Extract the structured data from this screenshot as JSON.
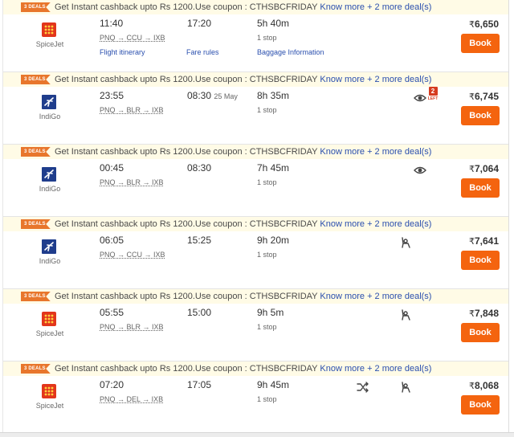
{
  "deal": {
    "badge": "3 DEALS",
    "text": "Get Instant cashback upto Rs 1200.Use coupon : CTHSBCFRIDAY ",
    "know_more": "Know more",
    "more_deals": "+ 2 more deal(s)"
  },
  "book_label": "Book",
  "currency": "₹",
  "links": {
    "itinerary": "Flight itinerary",
    "fare_rules": "Fare rules",
    "baggage": "Baggage Information"
  },
  "seats": {
    "count": "2",
    "label": "LEFT"
  },
  "flights": [
    {
      "airline": "SpiceJet",
      "dep": "11:40",
      "arr": "17:20",
      "arr_date": "",
      "route": "PNQ → CCU → IXB",
      "duration": "5h 40m",
      "stops": "1 stop",
      "price": "6,650"
    },
    {
      "airline": "IndiGo",
      "dep": "23:55",
      "arr": "08:30",
      "arr_date": "25 May",
      "route": "PNQ → BLR → IXB",
      "duration": "8h 35m",
      "stops": "1 stop",
      "price": "6,745"
    },
    {
      "airline": "IndiGo",
      "dep": "00:45",
      "arr": "08:30",
      "arr_date": "",
      "route": "PNQ → BLR → IXB",
      "duration": "7h 45m",
      "stops": "1 stop",
      "price": "7,064"
    },
    {
      "airline": "IndiGo",
      "dep": "06:05",
      "arr": "15:25",
      "arr_date": "",
      "route": "PNQ → CCU → IXB",
      "duration": "9h 20m",
      "stops": "1 stop",
      "price": "7,641"
    },
    {
      "airline": "SpiceJet",
      "dep": "05:55",
      "arr": "15:00",
      "arr_date": "",
      "route": "PNQ → BLR → IXB",
      "duration": "9h 5m",
      "stops": "1 stop",
      "price": "7,848"
    },
    {
      "airline": "SpiceJet",
      "dep": "07:20",
      "arr": "17:05",
      "arr_date": "",
      "route": "PNQ → DEL → IXB",
      "duration": "9h 45m",
      "stops": "1 stop",
      "price": "8,068"
    }
  ],
  "icon_names": {
    "spicejet": "spicejet-logo-icon",
    "indigo": "indigo-logo-icon",
    "eye": "eye-icon",
    "seat": "seat-recline-icon",
    "shuffle": "shuffle-icon"
  },
  "colors": {
    "book": "#f4640f",
    "link": "#2a4fae",
    "deal_badge": "#e8762c",
    "seats_left": "#d63b1f",
    "spicejet": "#e2361c",
    "indigo": "#1f3d8c"
  }
}
